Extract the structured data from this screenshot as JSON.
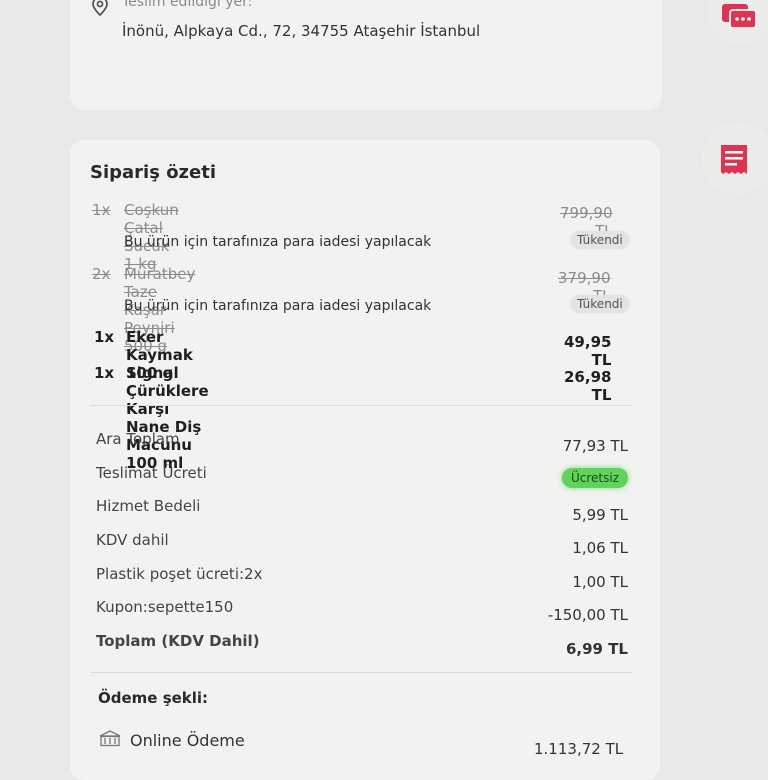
{
  "delivery": {
    "label": "Teslim edildiği yer:",
    "address": "İnönü, Alpkaya Cd., 72, 34755 Ataşehir İstanbul"
  },
  "summary": {
    "title": "Sipariş özeti",
    "items": [
      {
        "qty": "1x",
        "name": "Coşkun Çatal Sucuk 1 kg",
        "price": "799,90 TL",
        "refund_note": "Bu ürün için tarafınıza para iadesi yapılacak",
        "status": "Tükendi"
      },
      {
        "qty": "2x",
        "name": "Muratbey Taze Kaşar Peyniri 500 g",
        "price": "379,90 TL",
        "refund_note": "Bu ürün için tarafınıza para iadesi yapılacak",
        "status": "Tükendi"
      },
      {
        "qty": "1x",
        "name": "Eker Kaymak 100 g",
        "price": "49,95 TL"
      },
      {
        "qty": "1x",
        "name": "Signal Çürüklere Karşı Nane Diş Macunu 100 ml",
        "price": "26,98 TL"
      }
    ],
    "totals": {
      "subtotal_label": "Ara Toplam",
      "subtotal_value": "77,93 TL",
      "delivery_label": "Teslimat Ücreti",
      "delivery_value": "Ücretsiz",
      "service_label": "Hizmet Bedeli",
      "service_value": "5,99 TL",
      "vat_label": "KDV dahil",
      "vat_value": "1,06 TL",
      "bag_label": "Plastik poşet ücreti:2x",
      "bag_value": "1,00 TL",
      "coupon_label": "Kupon:sepette150",
      "coupon_value": "-150,00 TL",
      "total_label": "Toplam (KDV Dahil)",
      "total_value": "6,99 TL"
    },
    "payment": {
      "title": "Ödeme şekli:",
      "method": "Online Ödeme",
      "amount": "1.113,72 TL"
    }
  },
  "icons": {
    "location": "location-pin-icon",
    "chat": "chat-icon",
    "invoice": "invoice-icon",
    "bank": "bank-icon"
  },
  "colors": {
    "brand_red": "#e0334f",
    "free_green": "#5fd35b"
  }
}
